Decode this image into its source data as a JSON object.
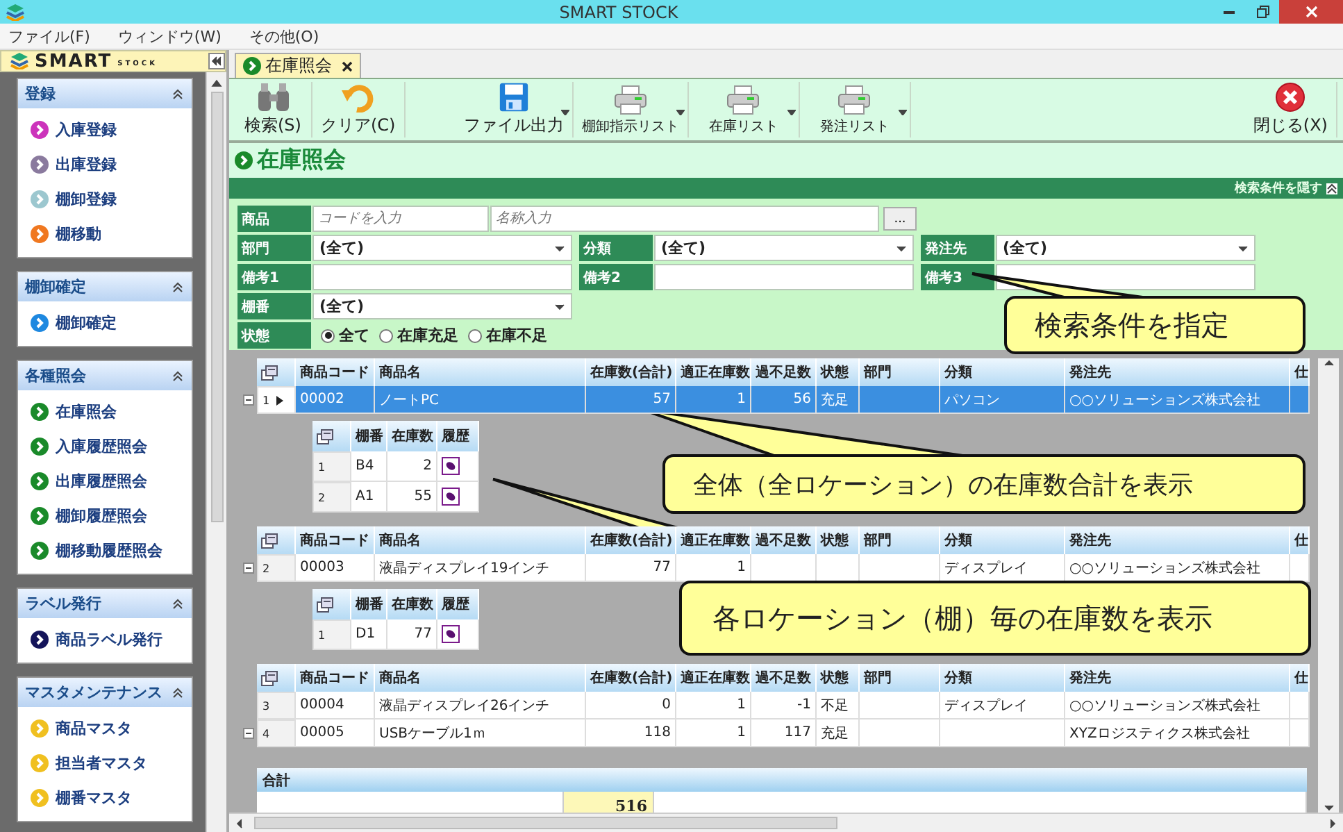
{
  "window": {
    "title": "SMART STOCK"
  },
  "menu": [
    {
      "label": "ファイル(F)"
    },
    {
      "label": "ウィンドウ(W)"
    },
    {
      "label": "その他(O)"
    }
  ],
  "sidebar": {
    "logo": "SMART",
    "logo_sub": "STOCK",
    "groups": [
      {
        "title": "登録",
        "expanded": true,
        "items": [
          {
            "label": "入庫登録",
            "color": "#cc33bb"
          },
          {
            "label": "出庫登録",
            "color": "#8a7a9e"
          },
          {
            "label": "棚卸登録",
            "color": "#9cc7cf"
          },
          {
            "label": "棚移動",
            "color": "#f07820"
          }
        ]
      },
      {
        "title": "棚卸確定",
        "expanded": true,
        "items": [
          {
            "label": "棚卸確定",
            "color": "#1e88e0"
          }
        ]
      },
      {
        "title": "各種照会",
        "expanded": true,
        "items": [
          {
            "label": "在庫照会",
            "color": "#1a8a2a"
          },
          {
            "label": "入庫履歴照会",
            "color": "#1a8a2a"
          },
          {
            "label": "出庫履歴照会",
            "color": "#1a8a2a"
          },
          {
            "label": "棚卸履歴照会",
            "color": "#1a8a2a"
          },
          {
            "label": "棚移動履歴照会",
            "color": "#1a8a2a"
          }
        ]
      },
      {
        "title": "ラベル発行",
        "expanded": true,
        "items": [
          {
            "label": "商品ラベル発行",
            "color": "#14145a"
          }
        ]
      },
      {
        "title": "マスタメンテナンス",
        "expanded": true,
        "items": [
          {
            "label": "商品マスタ",
            "color": "#f0c020"
          },
          {
            "label": "担当者マスタ",
            "color": "#f0c020"
          },
          {
            "label": "棚番マスタ",
            "color": "#f0c020"
          }
        ]
      }
    ]
  },
  "tabs": [
    {
      "label": "在庫照会",
      "selected": true
    }
  ],
  "toolbar": [
    {
      "label": "検索(S)",
      "kind": "binoculars",
      "dropdown": false
    },
    {
      "label": "クリア(C)",
      "kind": "undo",
      "dropdown": false
    },
    {
      "label": "ファイル出力",
      "kind": "disk",
      "dropdown": true
    },
    {
      "label": "棚卸指示リスト",
      "kind": "printer",
      "dropdown": true
    },
    {
      "label": "在庫リスト",
      "kind": "printer",
      "dropdown": true
    },
    {
      "label": "発注リスト",
      "kind": "printer",
      "dropdown": true
    },
    {
      "label": "閉じる(X)",
      "kind": "close",
      "dropdown": false
    }
  ],
  "page_title": "在庫照会",
  "filter_bar": {
    "toggle": "検索条件を隠す",
    "expanded": true
  },
  "search": {
    "rows": [
      [
        {
          "kind": "label",
          "text": "商品"
        },
        {
          "kind": "code",
          "placeholder": "コードを入力"
        },
        {
          "kind": "name",
          "placeholder": "名称入力"
        },
        {
          "kind": "ellipsis",
          "text": "..."
        }
      ],
      [
        {
          "kind": "label",
          "text": "部門"
        },
        {
          "kind": "select",
          "value": "(全て)"
        },
        {
          "kind": "label",
          "text": "分類"
        },
        {
          "kind": "select",
          "value": "(全て)"
        },
        {
          "kind": "label",
          "text": "発注先"
        },
        {
          "kind": "select",
          "value": "(全て)"
        }
      ],
      [
        {
          "kind": "label",
          "text": "備考1"
        },
        {
          "kind": "text"
        },
        {
          "kind": "label",
          "text": "備考2"
        },
        {
          "kind": "text"
        },
        {
          "kind": "label",
          "text": "備考3"
        },
        {
          "kind": "text"
        }
      ],
      [
        {
          "kind": "label",
          "text": "棚番"
        },
        {
          "kind": "select",
          "value": "(全て)"
        }
      ],
      [
        {
          "kind": "label",
          "text": "状態"
        },
        {
          "kind": "radios",
          "options": [
            {
              "label": "全て",
              "selected": true
            },
            {
              "label": "在庫充足",
              "selected": false
            },
            {
              "label": "在庫不足",
              "selected": false
            }
          ]
        }
      ]
    ]
  },
  "grid": {
    "sections": [
      {
        "columns": [
          "商品コード",
          "商品名",
          "在庫数(合計)",
          "適正在庫数",
          "過不足数",
          "状態",
          "部門",
          "分類",
          "発注先",
          "仕"
        ],
        "rows": [
          {
            "num": "1",
            "selected": true,
            "current": true,
            "expanded": true,
            "code": "00002",
            "name": "ノートPC",
            "total": "57",
            "proper": "1",
            "diff": "56",
            "status": "充足",
            "category": "パソコン",
            "supplier": "○○ソリューションズ株式会社",
            "locations": {
              "columns": [
                "棚番",
                "在庫数",
                "履歴"
              ],
              "rows": [
                {
                  "num": "1",
                  "shelf": "B4",
                  "qty": "2"
                },
                {
                  "num": "2",
                  "shelf": "A1",
                  "qty": "55"
                }
              ]
            }
          }
        ]
      },
      {
        "columns": [
          "商品コード",
          "商品名",
          "在庫数(合計)",
          "適正在庫数",
          "過不足数",
          "状態",
          "部門",
          "分類",
          "発注先",
          "仕"
        ],
        "rows": [
          {
            "num": "2",
            "selected": false,
            "current": false,
            "expanded": true,
            "code": "00003",
            "name": "液晶ディスプレイ19インチ",
            "total": "77",
            "proper": "1",
            "category": "ディスプレイ",
            "supplier": "○○ソリューションズ株式会社",
            "locations": {
              "columns": [
                "棚番",
                "在庫数",
                "履歴"
              ],
              "rows": [
                {
                  "num": "1",
                  "shelf": "D1",
                  "qty": "77"
                }
              ]
            }
          }
        ]
      },
      {
        "columns": [
          "商品コード",
          "商品名",
          "在庫数(合計)",
          "適正在庫数",
          "過不足数",
          "状態",
          "部門",
          "分類",
          "発注先",
          "仕"
        ],
        "rows": [
          {
            "num": "3",
            "selected": false,
            "current": false,
            "expanded": false,
            "code": "00004",
            "name": "液晶ディスプレイ26インチ",
            "total": "0",
            "proper": "1",
            "diff": "-1",
            "status": "不足",
            "category": "ディスプレイ",
            "supplier": "○○ソリューションズ株式会社"
          },
          {
            "num": "4",
            "selected": false,
            "current": false,
            "expanded": true,
            "code": "00005",
            "name": "USBケーブル1ｍ",
            "total": "118",
            "proper": "1",
            "diff": "117",
            "status": "充足",
            "supplier": "XYZロジスティクス株式会社"
          }
        ]
      }
    ],
    "totals": {
      "label": "合計",
      "value": "516"
    }
  },
  "callouts": [
    {
      "text": "検索条件を指定"
    },
    {
      "text": "全体（全ロケーション）の在庫数合計を表示"
    },
    {
      "text": "各ロケーション（棚）毎の在庫数を表示"
    }
  ]
}
